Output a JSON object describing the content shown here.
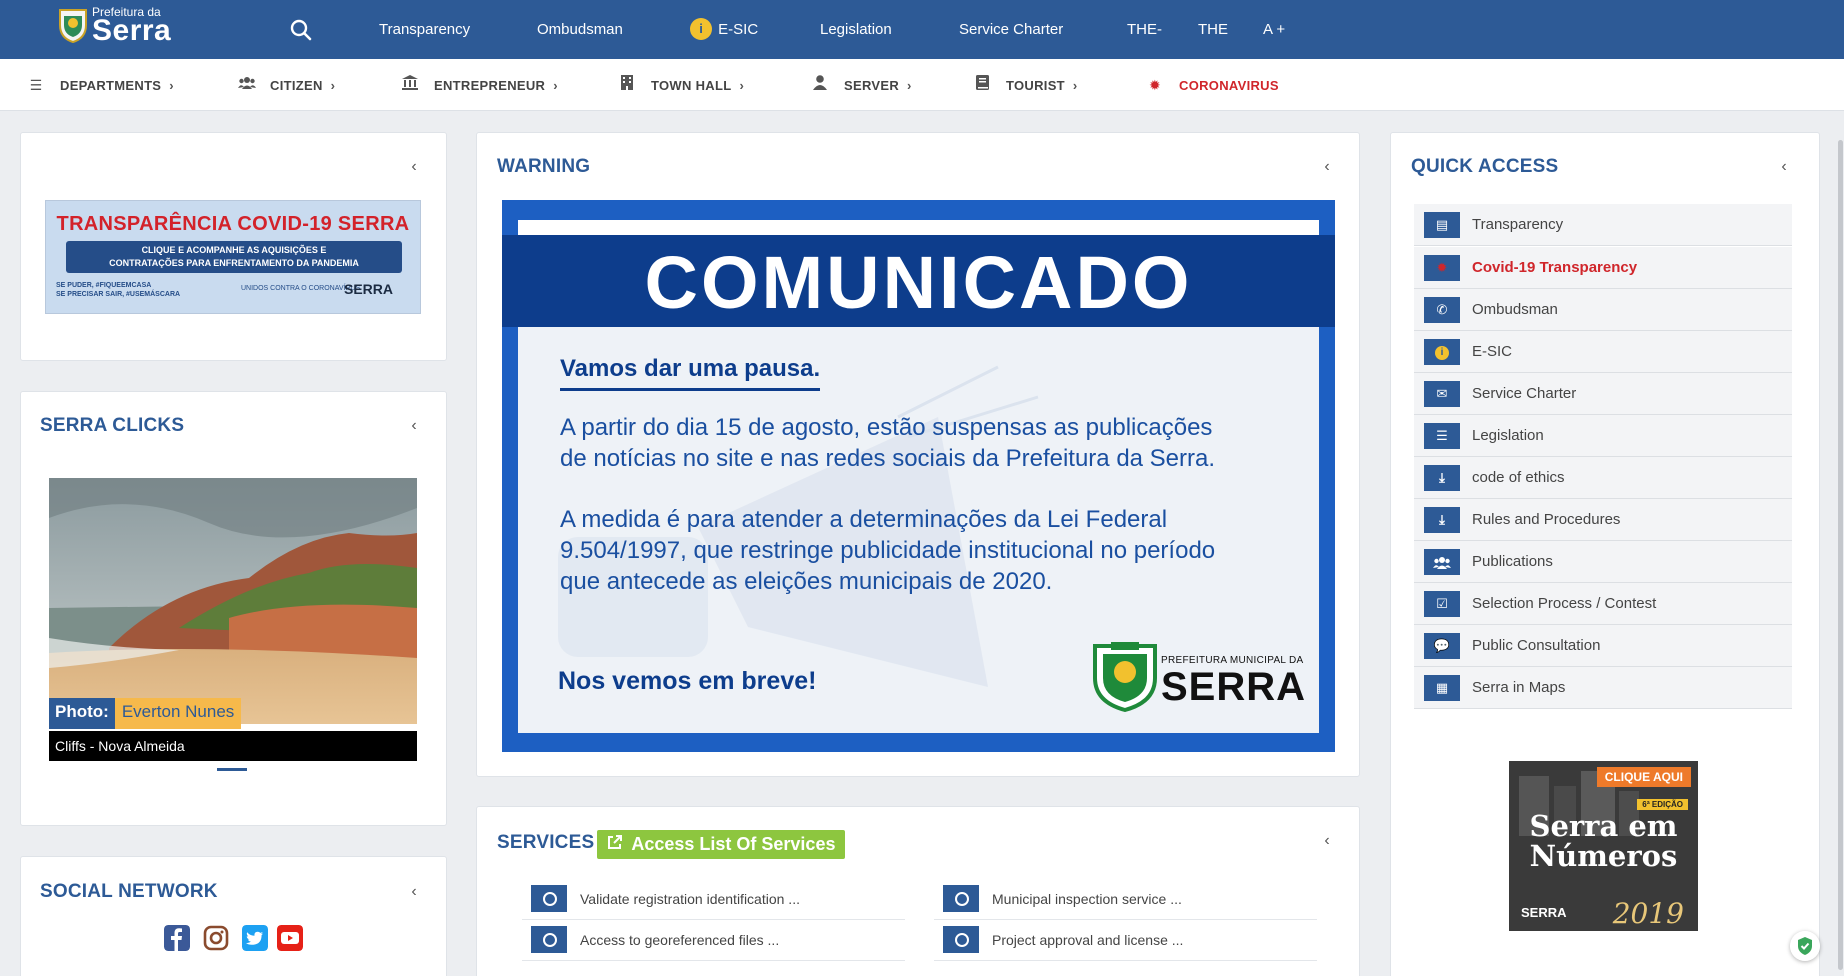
{
  "header": {
    "logo_small": "Prefeitura da",
    "logo_big": "Serra",
    "nav": [
      "Transparency",
      "Ombudsman",
      "E-SIC",
      "Legislation",
      "Service Charter",
      "THE-",
      "THE",
      "A +"
    ],
    "esic_badge": "i"
  },
  "subnav": {
    "items": [
      {
        "label": "DEPARTMENTS",
        "icon": "list-icon"
      },
      {
        "label": "CITIZEN",
        "icon": "users-icon"
      },
      {
        "label": "ENTREPRENEUR",
        "icon": "building-columns-icon"
      },
      {
        "label": "TOWN HALL",
        "icon": "building-icon"
      },
      {
        "label": "SERVER",
        "icon": "user-icon"
      },
      {
        "label": "TOURIST",
        "icon": "book-icon"
      },
      {
        "label": "CORONAVIRUS",
        "icon": "virus-icon",
        "color": "#d0262b"
      }
    ]
  },
  "covid_banner": {
    "title": "TRANSPARÊNCIA COVID-19 SERRA",
    "box_line1": "CLIQUE E ACOMPANHE AS AQUISIÇÕES E",
    "box_line2": "CONTRATAÇÕES PARA ENFRENTAMENTO DA PANDEMIA",
    "foot_line1": "SE PUDER, #FIQUEEMCASA",
    "foot_line2": "SE PRECISAR SAIR, #USEMÁSCARA",
    "foot_mid": "UNIDOS CONTRA O CORONAVÍRUS",
    "foot_logo": "SERRA"
  },
  "serra_clicks": {
    "title": "SERRA CLICKS",
    "photo_label": "Photo:",
    "photo_author": "Everton Nunes",
    "caption": "Cliffs - Nova Almeida"
  },
  "social": {
    "title": "SOCIAL NETWORK",
    "icons": [
      "facebook-icon",
      "instagram-icon",
      "twitter-icon",
      "youtube-icon"
    ]
  },
  "warning": {
    "title": "WARNING",
    "headline": "COMUNICADO",
    "subtitle": "Vamos dar uma pausa.",
    "p1_line1": "A partir do dia 15 de agosto, estão suspensas as publicações",
    "p1_line2": "de notícias no site e nas redes sociais da Prefeitura da Serra.",
    "p2_line1": "A medida é para atender a determinações da Lei Federal",
    "p2_line2": "9.504/1997, que restringe publicidade institucional no período",
    "p2_line3": "que antecede as eleições municipais de 2020.",
    "closing": "Nos vemos em breve!",
    "logo_small": "PREFEITURA MUNICIPAL DA",
    "logo_big": "SERRA"
  },
  "services": {
    "title": "SERVICES",
    "link_label": "Access List Of Services",
    "left": [
      "Validate registration identification ...",
      "Access to georeferenced files ..."
    ],
    "right": [
      "Municipal inspection service ...",
      "Project approval and license ..."
    ]
  },
  "quick_access": {
    "title": "QUICK ACCESS",
    "items": [
      {
        "label": "Transparency",
        "icon": "book-icon"
      },
      {
        "label": "Covid-19 Transparency",
        "icon": "virus-icon",
        "color": "#d0262b"
      },
      {
        "label": "Ombudsman",
        "icon": "phone-icon"
      },
      {
        "label": "E-SIC",
        "icon": "info-icon"
      },
      {
        "label": "Service Charter",
        "icon": "envelope-icon"
      },
      {
        "label": "Legislation",
        "icon": "list-icon"
      },
      {
        "label": "code of ethics",
        "icon": "download-icon"
      },
      {
        "label": "Rules and Procedures",
        "icon": "download-icon"
      },
      {
        "label": "Publications",
        "icon": "users-icon"
      },
      {
        "label": "Selection Process / Contest",
        "icon": "checkbox-icon"
      },
      {
        "label": "Public Consultation",
        "icon": "comments-icon"
      },
      {
        "label": "Serra in Maps",
        "icon": "map-icon"
      }
    ]
  },
  "serra_numeros": {
    "cta": "CLIQUE AQUI",
    "edition": "6ª EDIÇÃO",
    "title_line1": "Serra em",
    "title_line2": "Números",
    "year": "2019",
    "logo": "SERRA"
  },
  "colors": {
    "primary": "#2d5a96",
    "accent_red": "#d0262b",
    "accent_green": "#8dc63f",
    "accent_yellow": "#f2c12e"
  }
}
